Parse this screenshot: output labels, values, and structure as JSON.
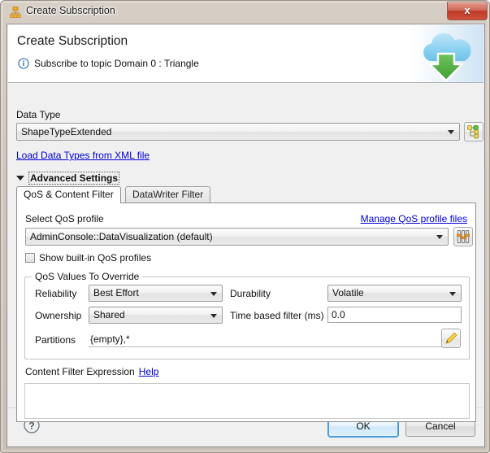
{
  "window": {
    "title": "Create Subscription",
    "title_icon": "node-tree-icon",
    "close_label": "x"
  },
  "banner": {
    "title": "Create Subscription",
    "subtitle": "Subscribe to topic Domain 0 : Triangle",
    "info_icon": "info-icon",
    "art_icon": "cloud-download-icon"
  },
  "data_type": {
    "label": "Data Type",
    "value": "ShapeTypeExtended",
    "browse_icon": "type-hierarchy-icon",
    "load_link": "Load Data Types from XML file"
  },
  "advanced": {
    "label": "Advanced Settings",
    "twisty_icon": "chevron-down-icon"
  },
  "tabs": [
    {
      "label": "QoS & Content Filter",
      "selected": true
    },
    {
      "label": "DataWriter Filter",
      "selected": false
    }
  ],
  "qos": {
    "select_label": "Select QoS profile",
    "manage_link": "Manage QoS profile files",
    "profile_value": "AdminConsole::DataVisualization (default)",
    "settings_icon": "sliders-icon",
    "show_builtin_label": "Show built-in QoS profiles",
    "show_builtin_checked": false,
    "group_title": "QoS Values To Override",
    "reliability_label": "Reliability",
    "reliability_value": "Best Effort",
    "durability_label": "Durability",
    "durability_value": "Volatile",
    "ownership_label": "Ownership",
    "ownership_value": "Shared",
    "time_filter_label": "Time based filter (ms)",
    "time_filter_value": "0.0",
    "partitions_label": "Partitions",
    "partitions_value": "{empty},*",
    "partitions_edit_icon": "pencil-icon"
  },
  "content_filter": {
    "label": "Content Filter Expression",
    "help_link": "Help",
    "expression_value": ""
  },
  "footer": {
    "help_icon": "question-mark-icon",
    "ok_label": "OK",
    "cancel_label": "Cancel"
  },
  "colors": {
    "link": "#0000d4",
    "close_red": "#bc3b27",
    "accent_blue": "#3c9ade",
    "cloud_blue": "#8fd0ef",
    "arrow_green": "#4caf3f"
  }
}
